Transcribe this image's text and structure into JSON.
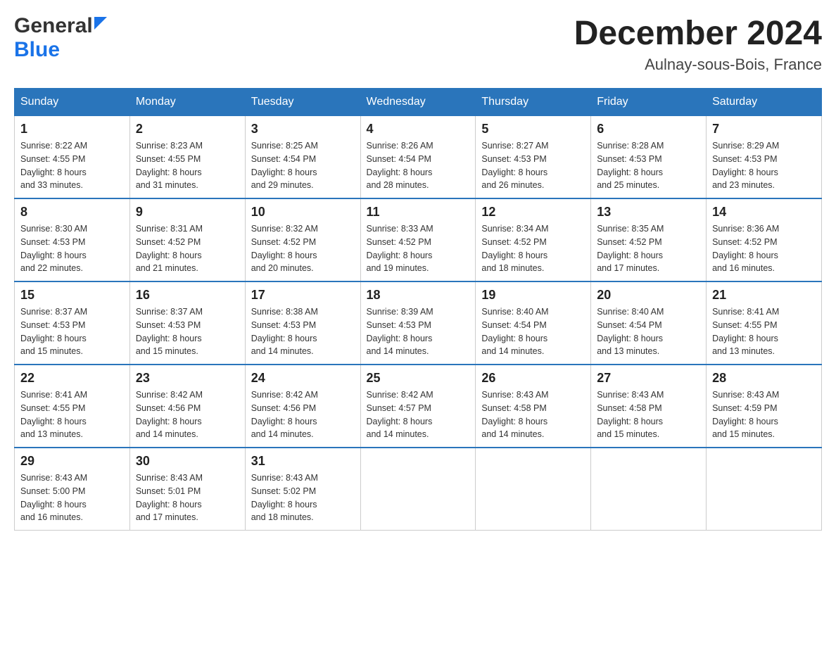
{
  "header": {
    "title": "December 2024",
    "subtitle": "Aulnay-sous-Bois, France",
    "logo_general": "General",
    "logo_blue": "Blue"
  },
  "calendar": {
    "days_of_week": [
      "Sunday",
      "Monday",
      "Tuesday",
      "Wednesday",
      "Thursday",
      "Friday",
      "Saturday"
    ],
    "weeks": [
      [
        {
          "day": "1",
          "sunrise": "8:22 AM",
          "sunset": "4:55 PM",
          "daylight": "8 hours and 33 minutes."
        },
        {
          "day": "2",
          "sunrise": "8:23 AM",
          "sunset": "4:55 PM",
          "daylight": "8 hours and 31 minutes."
        },
        {
          "day": "3",
          "sunrise": "8:25 AM",
          "sunset": "4:54 PM",
          "daylight": "8 hours and 29 minutes."
        },
        {
          "day": "4",
          "sunrise": "8:26 AM",
          "sunset": "4:54 PM",
          "daylight": "8 hours and 28 minutes."
        },
        {
          "day": "5",
          "sunrise": "8:27 AM",
          "sunset": "4:53 PM",
          "daylight": "8 hours and 26 minutes."
        },
        {
          "day": "6",
          "sunrise": "8:28 AM",
          "sunset": "4:53 PM",
          "daylight": "8 hours and 25 minutes."
        },
        {
          "day": "7",
          "sunrise": "8:29 AM",
          "sunset": "4:53 PM",
          "daylight": "8 hours and 23 minutes."
        }
      ],
      [
        {
          "day": "8",
          "sunrise": "8:30 AM",
          "sunset": "4:53 PM",
          "daylight": "8 hours and 22 minutes."
        },
        {
          "day": "9",
          "sunrise": "8:31 AM",
          "sunset": "4:52 PM",
          "daylight": "8 hours and 21 minutes."
        },
        {
          "day": "10",
          "sunrise": "8:32 AM",
          "sunset": "4:52 PM",
          "daylight": "8 hours and 20 minutes."
        },
        {
          "day": "11",
          "sunrise": "8:33 AM",
          "sunset": "4:52 PM",
          "daylight": "8 hours and 19 minutes."
        },
        {
          "day": "12",
          "sunrise": "8:34 AM",
          "sunset": "4:52 PM",
          "daylight": "8 hours and 18 minutes."
        },
        {
          "day": "13",
          "sunrise": "8:35 AM",
          "sunset": "4:52 PM",
          "daylight": "8 hours and 17 minutes."
        },
        {
          "day": "14",
          "sunrise": "8:36 AM",
          "sunset": "4:52 PM",
          "daylight": "8 hours and 16 minutes."
        }
      ],
      [
        {
          "day": "15",
          "sunrise": "8:37 AM",
          "sunset": "4:53 PM",
          "daylight": "8 hours and 15 minutes."
        },
        {
          "day": "16",
          "sunrise": "8:37 AM",
          "sunset": "4:53 PM",
          "daylight": "8 hours and 15 minutes."
        },
        {
          "day": "17",
          "sunrise": "8:38 AM",
          "sunset": "4:53 PM",
          "daylight": "8 hours and 14 minutes."
        },
        {
          "day": "18",
          "sunrise": "8:39 AM",
          "sunset": "4:53 PM",
          "daylight": "8 hours and 14 minutes."
        },
        {
          "day": "19",
          "sunrise": "8:40 AM",
          "sunset": "4:54 PM",
          "daylight": "8 hours and 14 minutes."
        },
        {
          "day": "20",
          "sunrise": "8:40 AM",
          "sunset": "4:54 PM",
          "daylight": "8 hours and 13 minutes."
        },
        {
          "day": "21",
          "sunrise": "8:41 AM",
          "sunset": "4:55 PM",
          "daylight": "8 hours and 13 minutes."
        }
      ],
      [
        {
          "day": "22",
          "sunrise": "8:41 AM",
          "sunset": "4:55 PM",
          "daylight": "8 hours and 13 minutes."
        },
        {
          "day": "23",
          "sunrise": "8:42 AM",
          "sunset": "4:56 PM",
          "daylight": "8 hours and 14 minutes."
        },
        {
          "day": "24",
          "sunrise": "8:42 AM",
          "sunset": "4:56 PM",
          "daylight": "8 hours and 14 minutes."
        },
        {
          "day": "25",
          "sunrise": "8:42 AM",
          "sunset": "4:57 PM",
          "daylight": "8 hours and 14 minutes."
        },
        {
          "day": "26",
          "sunrise": "8:43 AM",
          "sunset": "4:58 PM",
          "daylight": "8 hours and 14 minutes."
        },
        {
          "day": "27",
          "sunrise": "8:43 AM",
          "sunset": "4:58 PM",
          "daylight": "8 hours and 15 minutes."
        },
        {
          "day": "28",
          "sunrise": "8:43 AM",
          "sunset": "4:59 PM",
          "daylight": "8 hours and 15 minutes."
        }
      ],
      [
        {
          "day": "29",
          "sunrise": "8:43 AM",
          "sunset": "5:00 PM",
          "daylight": "8 hours and 16 minutes."
        },
        {
          "day": "30",
          "sunrise": "8:43 AM",
          "sunset": "5:01 PM",
          "daylight": "8 hours and 17 minutes."
        },
        {
          "day": "31",
          "sunrise": "8:43 AM",
          "sunset": "5:02 PM",
          "daylight": "8 hours and 18 minutes."
        },
        null,
        null,
        null,
        null
      ]
    ],
    "labels": {
      "sunrise": "Sunrise:",
      "sunset": "Sunset:",
      "daylight": "Daylight:"
    }
  }
}
